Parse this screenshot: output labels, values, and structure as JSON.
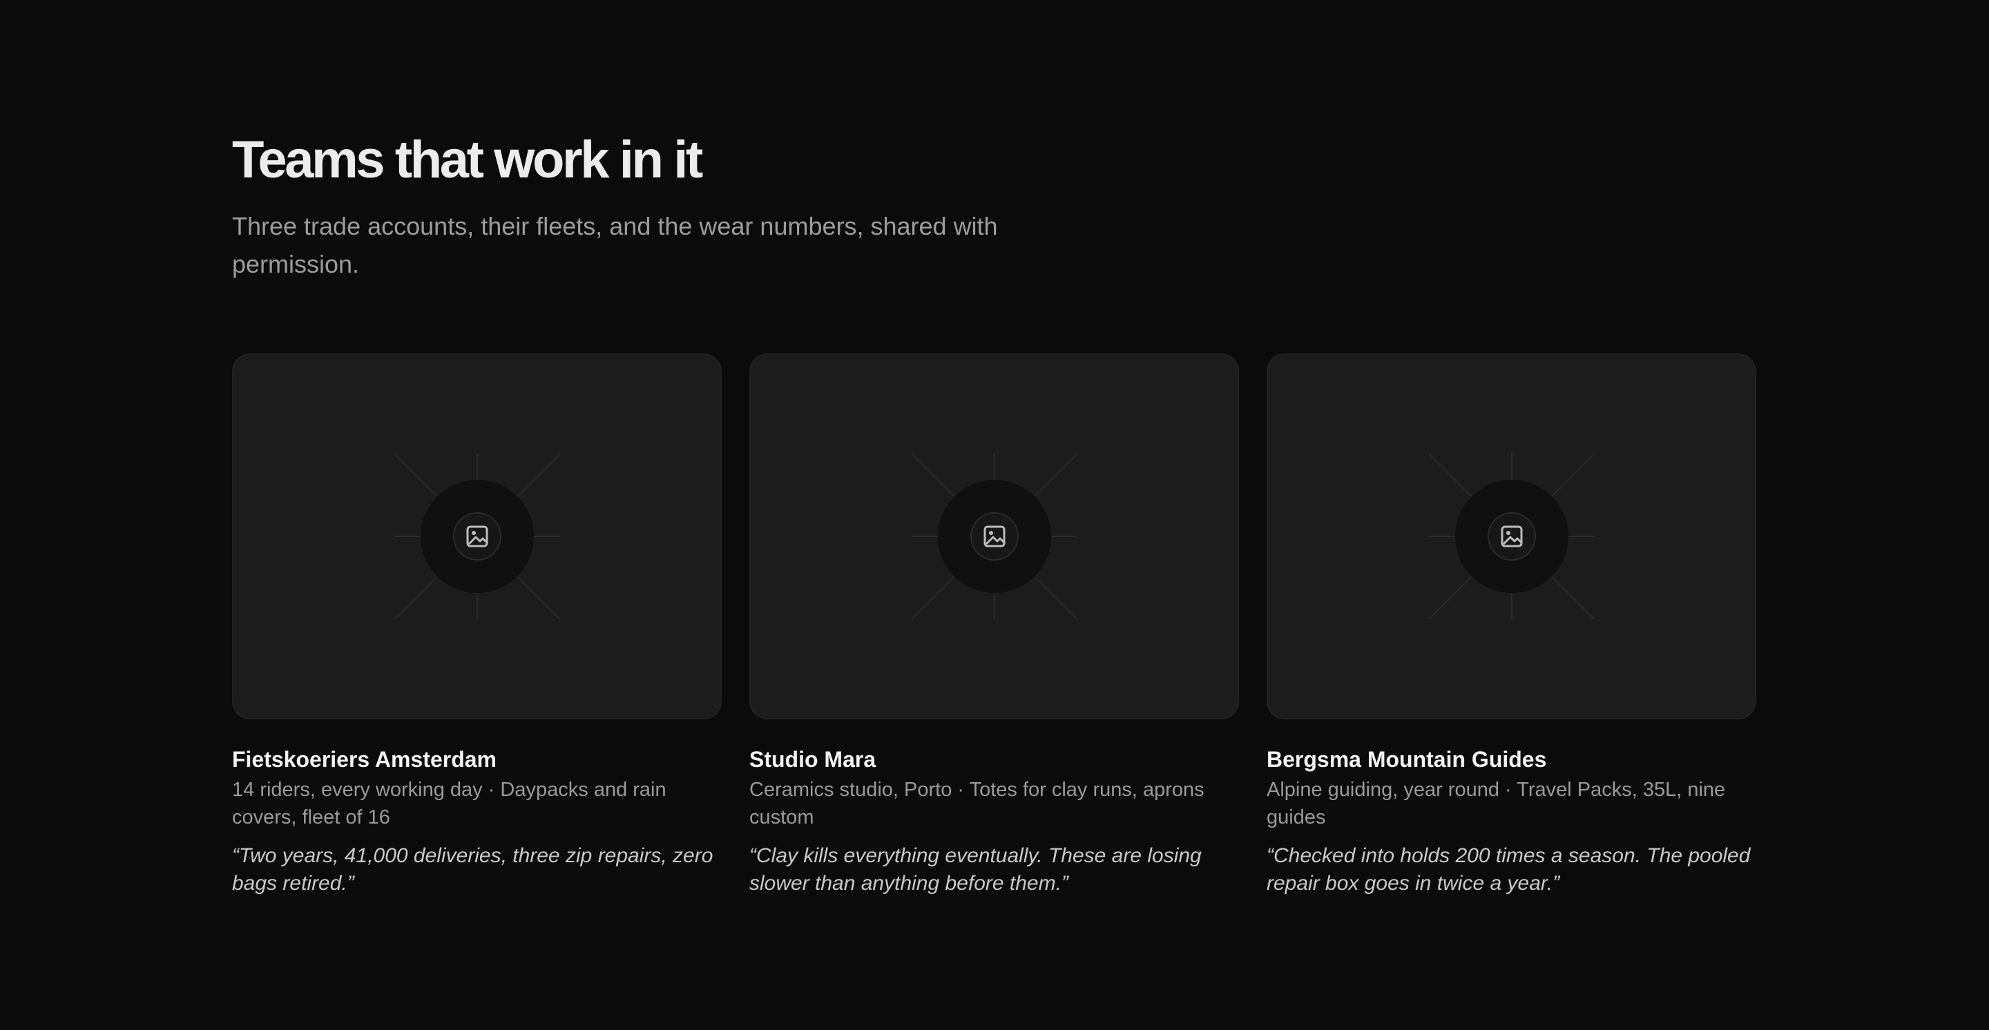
{
  "section": {
    "title": "Teams that work in it",
    "subtitle": "Three trade accounts, their fleets, and the wear numbers, shared with permission."
  },
  "teams": [
    {
      "name": "Fietskoeriers Amsterdam",
      "meta": "14 riders, every working day · Daypacks and rain covers, fleet of 16",
      "quote": "“Two years, 41,000 deliveries, three zip repairs, zero bags retired.”",
      "image_icon": "image-placeholder-icon"
    },
    {
      "name": "Studio Mara",
      "meta": "Ceramics studio, Porto · Totes for clay runs, aprons custom",
      "quote": "“Clay kills everything eventually. These are losing slower than anything before them.”",
      "image_icon": "image-placeholder-icon"
    },
    {
      "name": "Bergsma Mountain Guides",
      "meta": "Alpine guiding, year round · Travel Packs, 35L, nine guides",
      "quote": "“Checked into holds 200 times a season. The pooled repair box goes in twice a year.”",
      "image_icon": "image-placeholder-icon"
    }
  ],
  "colors": {
    "background": "#0b0b0b",
    "card": "#1c1c1c",
    "title": "#ececec",
    "muted": "#9a9a9a"
  }
}
